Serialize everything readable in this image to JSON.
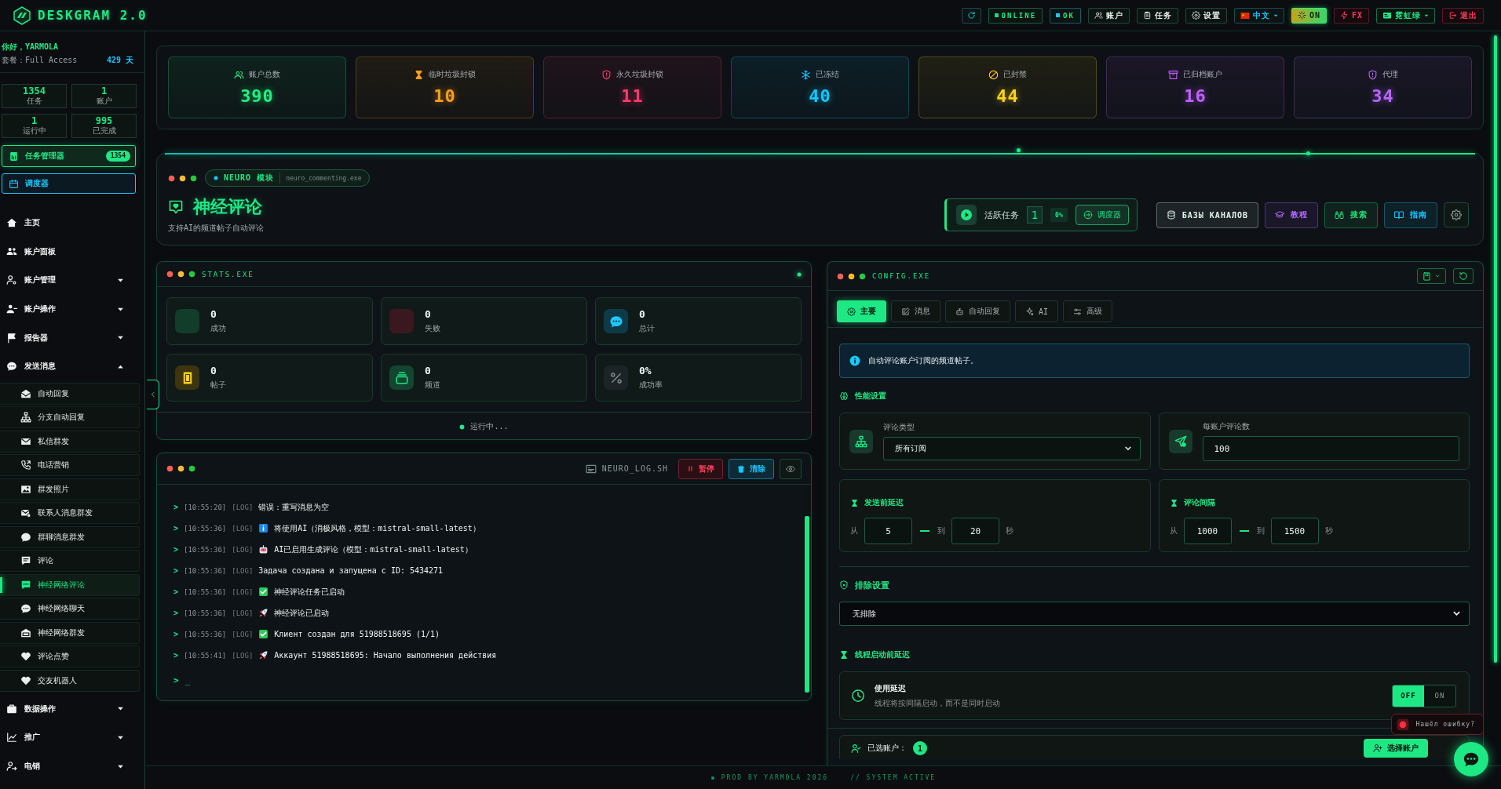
{
  "top_bar": {
    "logo": "DESKGRAM 2.0",
    "items": [
      {
        "kind": "refresh"
      },
      {
        "kind": "status",
        "label": "ONLINE",
        "color": "#1fd67a"
      },
      {
        "kind": "status",
        "label": "OK",
        "color": "#19c8ff"
      },
      {
        "kind": "nav",
        "label": "账户"
      },
      {
        "kind": "nav",
        "label": "任务"
      },
      {
        "kind": "nav",
        "label": "设置"
      },
      {
        "kind": "language",
        "label": "中文"
      },
      {
        "kind": "power",
        "label": "ON",
        "on": true
      },
      {
        "kind": "fx",
        "label": "FX"
      },
      {
        "kind": "theme",
        "label": "霓虹绿"
      },
      {
        "kind": "logout",
        "label": "退出"
      }
    ]
  },
  "sidebar": {
    "greeting": "你好，YARMOLA",
    "plan": "套餐：Full Access",
    "days": "429 天",
    "stats": [
      {
        "value": "1354",
        "label": "任务"
      },
      {
        "value": "1",
        "label": "账户"
      },
      {
        "value": "1",
        "label": "运行中"
      },
      {
        "value": "995",
        "label": "已完成"
      }
    ],
    "task_manager": {
      "label": "任务管理器",
      "count": "1354"
    },
    "scheduler": {
      "label": "调度器"
    },
    "items": [
      {
        "label": "主页",
        "selected": false
      },
      {
        "label": "账户面板",
        "selected": false
      },
      {
        "label": "账户管理",
        "selected": false,
        "expanded": false
      },
      {
        "label": "账户操作",
        "selected": false,
        "expanded": false
      },
      {
        "label": "报告器",
        "selected": false,
        "expanded": false
      },
      {
        "label": "发送消息",
        "selected": false,
        "expanded": true,
        "children": [
          {
            "label": "自动回复",
            "selected": false
          },
          {
            "label": "分支自动回复",
            "selected": false
          },
          {
            "label": "私信群发",
            "selected": false
          },
          {
            "label": "电话营销",
            "selected": false
          },
          {
            "label": "群发照片",
            "selected": false
          },
          {
            "label": "联系人消息群发",
            "selected": false
          },
          {
            "label": "群聊消息群发",
            "selected": false
          },
          {
            "label": "评论",
            "selected": false
          },
          {
            "label": "神经网络评论",
            "selected": true
          },
          {
            "label": "神经网络聊天",
            "selected": false
          },
          {
            "label": "神经网络群发",
            "selected": false
          },
          {
            "label": "评论点赞",
            "selected": false
          },
          {
            "label": "交友机器人",
            "selected": false
          }
        ]
      },
      {
        "label": "数据操作",
        "selected": false,
        "expanded": false
      },
      {
        "label": "推广",
        "selected": false,
        "expanded": false
      },
      {
        "label": "电销",
        "selected": false,
        "expanded": false
      }
    ]
  },
  "account_stats": [
    {
      "label": "账户总数",
      "value": "390",
      "color": "#22f07f"
    },
    {
      "label": "临时垃圾封锁",
      "value": "10",
      "color": "#ff9f1a"
    },
    {
      "label": "永久垃圾封锁",
      "value": "11",
      "color": "#ff3b6b"
    },
    {
      "label": "已冻结",
      "value": "40",
      "color": "#12c8ff"
    },
    {
      "label": "已封禁",
      "value": "44",
      "color": "#ffd21a"
    },
    {
      "label": "已归档账户",
      "value": "16",
      "color": "#c060ff"
    },
    {
      "label": "代理",
      "value": "34",
      "color": "#b866ff"
    }
  ],
  "module": {
    "tag": "NEURO 模块",
    "file": "neuro_commenting.exe",
    "title": "神经评论",
    "subtitle": "支持AI的频道帖子自动评论",
    "active_tasks": {
      "label": "活跃任务",
      "count": "1",
      "percent": "0%",
      "button": "调度器"
    },
    "buttons": [
      {
        "kind": "text",
        "label": "БАЗЫ КАНАЛОВ",
        "color": "#dff5ea"
      },
      {
        "kind": "text",
        "label": "教程",
        "color": "#b56cff"
      },
      {
        "kind": "text",
        "label": "搜索",
        "color": "#22e07a"
      },
      {
        "kind": "text",
        "label": "指南",
        "color": "#19c8ff"
      },
      {
        "kind": "settings"
      }
    ]
  },
  "stats_panel": {
    "title": "STATS.EXE",
    "cards": [
      {
        "value": "0",
        "label": "成功",
        "color": "#123d2a"
      },
      {
        "value": "0",
        "label": "失败",
        "color": "#3a1820"
      },
      {
        "value": "0",
        "label": "总计",
        "color": "#0e3a48"
      },
      {
        "value": "0",
        "label": "帖子",
        "color": "#3d3410"
      },
      {
        "value": "0",
        "label": "频道",
        "color": "#134530"
      },
      {
        "value": "0%",
        "label": "成功率",
        "color": "#1c2428"
      }
    ],
    "status": "运行中..."
  },
  "log_panel": {
    "title": "NEURO_LOG.SH",
    "buttons": [
      {
        "kind": "pause",
        "label": "暂停"
      },
      {
        "kind": "clear",
        "label": "清除"
      },
      {
        "kind": "view"
      }
    ],
    "lines": [
      {
        "prompt": ">",
        "time": "[10:55:20]",
        "tag": "[LOG]",
        "kind": "plain",
        "text": "错误：重写消息为空"
      },
      {
        "prompt": ">",
        "time": "[10:55:36]",
        "tag": "[LOG]",
        "kind": "info",
        "text": "将使用AI（消极风格，模型：mistral-small-latest）"
      },
      {
        "prompt": ">",
        "time": "[10:55:36]",
        "tag": "[LOG]",
        "kind": "bot",
        "text": "AI已启用生成评论（模型：mistral-small-latest）"
      },
      {
        "prompt": ">",
        "time": "[10:55:36]",
        "tag": "[LOG]",
        "kind": "plain",
        "text": "Задача создана и запущена с ID: 5434271"
      },
      {
        "prompt": ">",
        "time": "[10:55:36]",
        "tag": "[LOG]",
        "kind": "success",
        "text": "神经评论任务已启动"
      },
      {
        "prompt": ">",
        "time": "[10:55:36]",
        "tag": "[LOG]",
        "kind": "launch",
        "text": "神经评论已启动"
      },
      {
        "prompt": ">",
        "time": "[10:55:36]",
        "tag": "[LOG]",
        "kind": "success",
        "text": "Клиент создан для 51988518695 (1/1)"
      },
      {
        "prompt": ">",
        "time": "[10:55:41]",
        "tag": "[LOG]",
        "kind": "launch",
        "text": "Аккаунт 51988518695: Начало выполнения действия"
      }
    ],
    "input_prompt": ">",
    "cursor": "_"
  },
  "config_panel": {
    "title": "CONFIG.EXE",
    "tabs": [
      {
        "label": "主要",
        "selected": true
      },
      {
        "label": "消息",
        "selected": false
      },
      {
        "label": "自动回复",
        "selected": false
      },
      {
        "label": "AI",
        "selected": false
      },
      {
        "label": "高级",
        "selected": false
      }
    ],
    "info": "自动评论账户订阅的频道帖子。",
    "performance": {
      "title": "性能设置",
      "comment_type": {
        "label": "评论类型",
        "value": "所有订阅"
      },
      "per_account": {
        "label": "每账户评论数",
        "value": "100"
      },
      "delays": [
        {
          "title": "发送前延迟",
          "from_label": "从",
          "from": "5",
          "to_label": "到",
          "to": "20",
          "unit": "秒"
        },
        {
          "title": "评论间隔",
          "from_label": "从",
          "from": "1000",
          "to_label": "到",
          "to": "1500",
          "unit": "秒"
        }
      ]
    },
    "exclusion": {
      "title": "排除设置",
      "value": "无排除"
    },
    "thread_delay": {
      "title": "线程启动前延迟",
      "label": "使用延迟",
      "description": "线程将按间隔启动，而不是同时启动",
      "options": [
        {
          "label": "OFF",
          "selected": true
        },
        {
          "label": "ON",
          "selected": false
        }
      ]
    },
    "accounts": {
      "label": "已选账户：",
      "count": "1",
      "button": "选择账户"
    }
  },
  "bug_report": {
    "label": "Нашёл ошибку?"
  },
  "footer": {
    "credit": "PROD BY YARMOLA 2026",
    "status": "// SYSTEM ACTIVE"
  }
}
